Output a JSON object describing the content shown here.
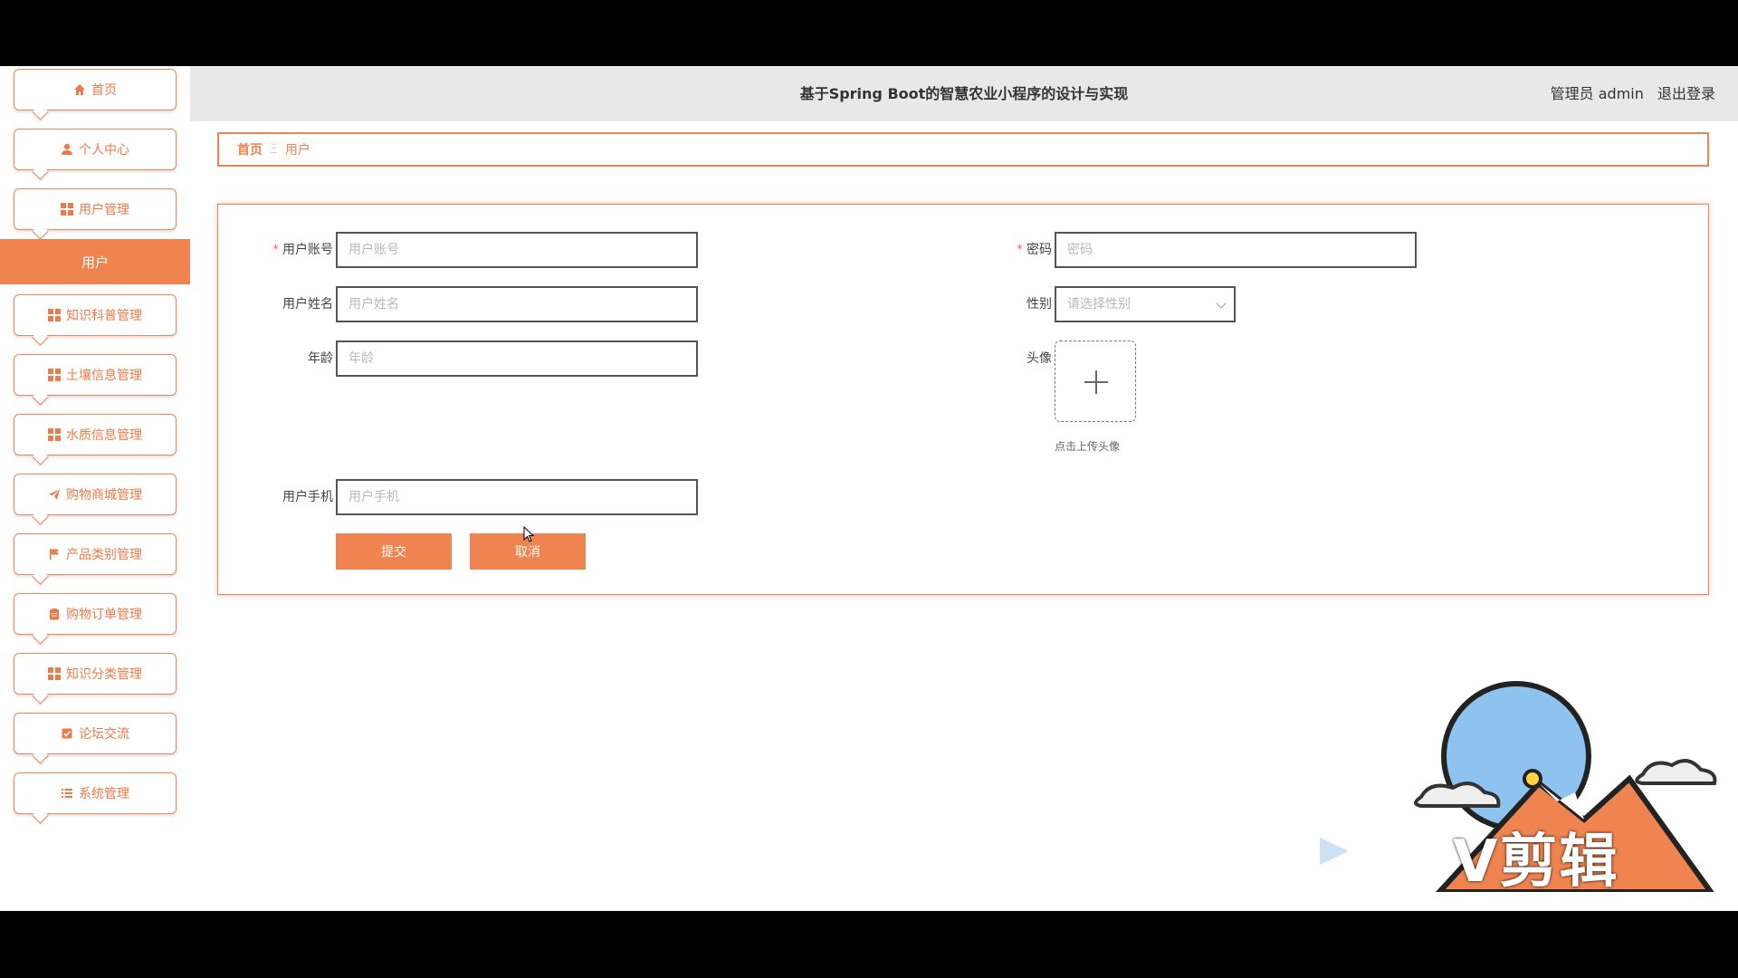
{
  "header": {
    "title": "基于Spring Boot的智慧农业小程序的设计与实现",
    "user_role": "管理员 admin",
    "logout_label": "退出登录"
  },
  "sidebar": {
    "items": [
      {
        "label": "首页",
        "icon": "home-icon"
      },
      {
        "label": "个人中心",
        "icon": "person-icon"
      },
      {
        "label": "用户管理",
        "icon": "grid-icon"
      },
      {
        "label": "知识科普管理",
        "icon": "grid-icon"
      },
      {
        "label": "土壤信息管理",
        "icon": "grid-icon"
      },
      {
        "label": "水质信息管理",
        "icon": "grid-icon"
      },
      {
        "label": "购物商城管理",
        "icon": "paper-plane-icon"
      },
      {
        "label": "产品类别管理",
        "icon": "flag-icon"
      },
      {
        "label": "购物订单管理",
        "icon": "clipboard-icon"
      },
      {
        "label": "知识分类管理",
        "icon": "grid-icon"
      },
      {
        "label": "论坛交流",
        "icon": "checkbox-icon"
      },
      {
        "label": "系统管理",
        "icon": "list-icon"
      }
    ],
    "active_sub": "用户"
  },
  "breadcrumb": {
    "home": "首页",
    "separator": "Ξ",
    "current": "用户"
  },
  "form": {
    "account_label": "用户账号",
    "account_placeholder": "用户账号",
    "password_label": "密码",
    "password_placeholder": "密码",
    "name_label": "用户姓名",
    "name_placeholder": "用户姓名",
    "gender_label": "性别",
    "gender_placeholder": "请选择性别",
    "age_label": "年龄",
    "age_placeholder": "年龄",
    "avatar_label": "头像",
    "avatar_tip": "点击上传头像",
    "phone_label": "用户手机",
    "phone_placeholder": "用户手机",
    "required_mark": "*",
    "submit_label": "提交",
    "cancel_label": "取消"
  },
  "watermark": {
    "text": "V剪辑"
  },
  "colors": {
    "accent": "#f08450",
    "header_bg": "#e8e8e8"
  }
}
